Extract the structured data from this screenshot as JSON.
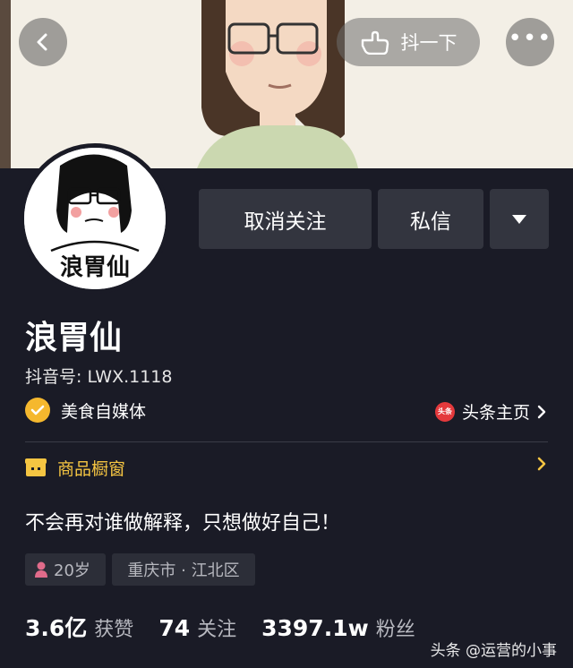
{
  "header": {
    "shake_label": "抖一下",
    "more_label": "•••"
  },
  "actions": {
    "unfollow_label": "取消关注",
    "message_label": "私信",
    "dropdown_label": "▼"
  },
  "avatar": {
    "caption": "浪胃仙"
  },
  "profile": {
    "name": "浪胃仙",
    "douyin_id": "抖音号: LWX.1118",
    "verification": "美食自媒体",
    "toutiao_link": "头条主页",
    "toutiao_logo_text": "头条",
    "shop_label": "商品橱窗",
    "bio": "不会再对谁做解释，只想做好自己！"
  },
  "tags": {
    "age": "20岁",
    "location": "重庆市 · 江北区"
  },
  "stats": {
    "likes_value": "3.6亿",
    "likes_label": "获赞",
    "following_value": "74",
    "following_label": "关注",
    "followers_value": "3397.1w",
    "followers_label": "粉丝"
  },
  "watermark": "头条 @运营的小事",
  "colors": {
    "background": "#1a1b26",
    "button": "#33353f",
    "verify_badge": "#f5b82e",
    "shop_accent": "#f5c542",
    "toutiao_red": "#e4393c"
  }
}
